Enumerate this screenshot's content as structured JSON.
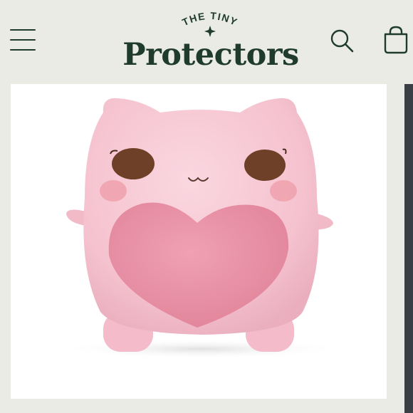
{
  "header": {
    "logo_top": "THE TINY",
    "logo_main": "Protectors",
    "menu_icon": "hamburger-menu-icon",
    "search_icon": "search-icon",
    "cart_icon": "shopping-bag-icon"
  },
  "product": {
    "image_subject": "pink-heart-plush-toy",
    "colors": {
      "body": "#f5c2cf",
      "heart": "#e98fa4",
      "eyes": "#6e4028",
      "cheeks": "#eea1ad"
    }
  },
  "colors": {
    "brand_green": "#1f3b2c",
    "header_bg": "#e9ebe4",
    "card_bg": "#ffffff"
  }
}
